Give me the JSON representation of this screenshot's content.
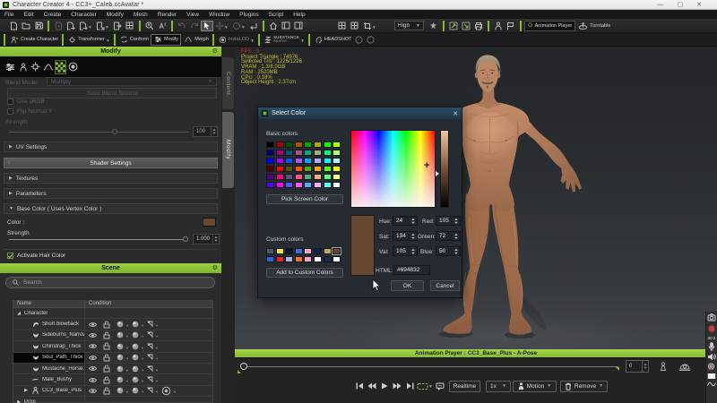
{
  "window": {
    "title": "Character Creator 4 - CC3+_Caleb.ccAvatar *",
    "controls": {
      "minimize": "—",
      "maximize": "▢",
      "close": "✕"
    }
  },
  "menu": {
    "items": [
      "File",
      "Edit",
      "Create",
      "Character",
      "Modify",
      "Mesh",
      "Render",
      "View",
      "Window",
      "Plugins",
      "Script",
      "Help"
    ]
  },
  "toolbar": {
    "icons_group1": [
      {
        "name": "new-document-icon",
        "icon": "doc"
      },
      {
        "name": "open-project-icon",
        "icon": "folder"
      },
      {
        "name": "save-project-icon",
        "icon": "save"
      }
    ],
    "icons_group2": [
      {
        "name": "import-file-icon",
        "icon": "doc-plus",
        "dim": true
      },
      {
        "name": "export-file-icon",
        "icon": "doc-arrow"
      },
      {
        "name": "send-to-iclone-icon",
        "icon": "doc-arrow2",
        "dd": true
      },
      {
        "name": "export-fbx-icon",
        "icon": "doc-arrow3",
        "dd": true
      },
      {
        "name": "goz-icon",
        "icon": "doc-out"
      },
      {
        "name": "texture-grid-icon",
        "icon": "grid"
      }
    ],
    "icons_group3": [
      {
        "name": "zoom-selected-icon",
        "icon": "zoom-a"
      },
      {
        "name": "zoom-all-icon",
        "icon": "zoom-b"
      }
    ],
    "icons_group4": [
      {
        "name": "undo-icon",
        "icon": "undo",
        "dim": true
      },
      {
        "name": "redo-icon",
        "icon": "redo",
        "dim": true
      },
      {
        "name": "select-tool-icon",
        "icon": "cursor",
        "active": true
      },
      {
        "name": "move-tool-icon",
        "icon": "move",
        "dim": true,
        "dd": true
      },
      {
        "name": "rotate-tool-icon",
        "icon": "rotate",
        "dim": true,
        "dd": true
      },
      {
        "name": "reset-transform-icon",
        "icon": "corner-arrow"
      }
    ],
    "icons_group5": [
      {
        "name": "home-camera-icon",
        "icon": "home"
      },
      {
        "name": "dock-left-icon",
        "icon": "panel"
      },
      {
        "name": "dock-right-icon",
        "icon": "panel2"
      }
    ],
    "icons_group6": [
      {
        "name": "preview-grid-icon",
        "icon": "grid"
      },
      {
        "name": "preview-grid2-icon",
        "icon": "grid"
      },
      {
        "name": "snapshot-icon",
        "icon": "crop",
        "dd": true
      }
    ],
    "quality_label": "High",
    "icons_group7": [
      {
        "name": "realtime-render-icon",
        "icon": "star"
      }
    ],
    "icons_group8": [
      {
        "name": "calibrate-a-icon",
        "icon": "lamp",
        "green": true
      },
      {
        "name": "calibrate-b-icon",
        "icon": "lamp2",
        "green": true
      },
      {
        "name": "render-image-icon",
        "icon": "printer"
      }
    ],
    "icons_group9": [
      {
        "name": "link-character-icon",
        "icon": "person"
      },
      {
        "name": "flag-pose-icon",
        "icon": "flag"
      }
    ],
    "animation_player_label": "Animation Player",
    "turntable_label": "Turntable"
  },
  "mode_toolbar": {
    "items": [
      {
        "label": "Create Character",
        "icon": "person-plus"
      },
      {
        "sep": true
      },
      {
        "label": "Transformer",
        "icon": "transformer",
        "dd": true
      },
      {
        "sep": true
      },
      {
        "label": "Conform",
        "icon": "conform"
      },
      {
        "label": "Modify",
        "icon": "sliders",
        "pressed": true
      },
      {
        "label": "Morph",
        "icon": "morph"
      },
      {
        "sep": true
      },
      {
        "label": "InstaLOD",
        "icon": "instalod",
        "dim": true,
        "dd": true
      },
      {
        "sep": true
      },
      {
        "label": "SUBSTANCE",
        "sublabel": "PAINTER",
        "icon": "substance",
        "dd": true
      },
      {
        "sep": true
      },
      {
        "label": "HEADSHOT",
        "icon": "headshot"
      }
    ]
  },
  "left_panel": {
    "modify": {
      "title": "Modify",
      "side_tabs": [
        "Content",
        "Modify"
      ],
      "tool_icons": [
        "adjust-sliders-icon",
        "skin-weight-icon",
        "bone-edit-icon",
        "sculpt-icon",
        "texture-checker-icon",
        "node-material-icon"
      ],
      "active_tool_index": 4,
      "blend_mode_label": "Blend Mode",
      "blend_mode_value": "Multiply",
      "save_blend_label": "Save Blend Texture",
      "use_srgb_label": "Use sRGB",
      "flip_normal_label": "Flip Normal Y",
      "strength_label": "Strength",
      "strength_value": "100",
      "uv_settings_label": "UV Settings",
      "shader_settings_label": "Shader Settings",
      "textures_label": "Textures",
      "parameters_label": "Parameters",
      "base_color_label": "Base Color ( Uses Vertex Color )",
      "color_label": "Color :",
      "color_value": "#694832",
      "strength2_label": "Strength",
      "strength2_value": "1.000",
      "activate_hair_label": "Activate Hair Color"
    },
    "scene": {
      "title": "Scene",
      "search_placeholder": "Search",
      "columns": [
        "Name",
        "Condition"
      ],
      "rows": [
        {
          "label": "Character",
          "group": true,
          "expanded": true,
          "level": 0
        },
        {
          "label": "Short blowback",
          "icon": "hair",
          "level": 1
        },
        {
          "label": "Sideburns_Narrow",
          "icon": "beard",
          "level": 1
        },
        {
          "label": "Chinstrap_Thick",
          "icon": "beard",
          "level": 1
        },
        {
          "label": "Soul_Path_Thick",
          "icon": "beard",
          "level": 1,
          "selected": true
        },
        {
          "label": "Mustache_Horse...",
          "icon": "beard",
          "level": 1
        },
        {
          "label": "Male_Bushy",
          "icon": "brow",
          "level": 1
        },
        {
          "label": "CC3_Base_Plus",
          "icon": "person",
          "level": 1,
          "expandable": true,
          "extra": true
        },
        {
          "label": "Prop",
          "group": true,
          "expanded": false,
          "level": 0
        }
      ],
      "condition_icons": [
        "visibility-eye-icon",
        "lock-icon",
        "material-ball-icon",
        "shadow-ball-icon",
        "render-state-icon"
      ],
      "extra_condition_icon": "physics-target-icon"
    }
  },
  "viewport": {
    "stats": [
      {
        "text": "FPS : 0",
        "red": true
      },
      {
        "text": "Project Triangle : 74976"
      },
      {
        "text": "Selected Tris : 1226/1226"
      },
      {
        "text": "VRAM : 1.3/8.0GB"
      },
      {
        "text": "RAM : 2520MB"
      },
      {
        "text": "CPU : 0.18%"
      },
      {
        "text": "Object Height : 2.37cm"
      }
    ]
  },
  "color_dialog": {
    "title": "Select Color",
    "basic_colors_label": "Basic colors",
    "pick_screen_label": "Pick Screen Color",
    "custom_colors_label": "Custom colors",
    "add_custom_label": "Add to Custom Colors",
    "hue_label": "Hue:",
    "hue_value": "24",
    "sat_label": "Sat:",
    "sat_value": "134",
    "val_label": "Val:",
    "val_value": "105",
    "red_label": "Red:",
    "red_value": "105",
    "green_label": "Green:",
    "green_value": "72",
    "blue_label": "Blue:",
    "blue_value": "50",
    "html_label": "HTML:",
    "html_value": "#694832",
    "ok_label": "OK",
    "cancel_label": "Cancel",
    "current_color": "#694832",
    "basic_colors": [
      "#000000",
      "#aa0000",
      "#005500",
      "#aa5500",
      "#00aa00",
      "#aaaa00",
      "#00ff00",
      "#aaff00",
      "#00007f",
      "#aa007f",
      "#00557f",
      "#aa557f",
      "#00aa7f",
      "#aaaa7f",
      "#00ff7f",
      "#aaff7f",
      "#0000ff",
      "#aa00ff",
      "#0055ff",
      "#aa55ff",
      "#00aaff",
      "#aaaaff",
      "#00ffff",
      "#aaffff",
      "#550000",
      "#ff0000",
      "#555500",
      "#ff5500",
      "#55aa00",
      "#ffaa00",
      "#55ff00",
      "#ffff00",
      "#55007f",
      "#ff007f",
      "#55557f",
      "#ff557f",
      "#55aa7f",
      "#ffaa7f",
      "#55ff7f",
      "#ffff7f",
      "#5500ff",
      "#ff00ff",
      "#5555ff",
      "#ff55ff",
      "#55aaff",
      "#ffaaff",
      "#55ffff",
      "#ffffff"
    ],
    "custom_colors": [
      "#4e5a66",
      "#f2e438",
      "#0a1430",
      "#3c6cd4",
      "#f2a8c4",
      "#122448",
      "#cba468",
      "#694832",
      "#2864e4",
      "#e02424",
      "#a8b4e4",
      "#f27224",
      "#f2a8bc",
      "#ffffff",
      "#122c54",
      "#ffffff"
    ],
    "custom_selected_index": 7
  },
  "bottom_bar": {
    "animation_player_text": "Animation Player : CC3_Base_Plus - A-Pose",
    "frame_value": "0",
    "transport_icons": [
      "skip-start-icon",
      "step-back-icon",
      "play-icon",
      "step-forward-icon",
      "skip-end-icon"
    ],
    "loop_icon": "loop-range-icon",
    "bubble_icon": "comment-bubble-icon",
    "realtime_label": "Realtime",
    "speed_value": "1x",
    "motion_label": "Motion",
    "remove_label": "Remove",
    "avatar_icon": "avatar-mark-icon",
    "camera_icon": "camera-dome-icon"
  },
  "recorder": {
    "time": "00:3",
    "icons": [
      "capture-settings-icon",
      "record-button-icon",
      "microphone-icon",
      "speaker-icon",
      "webcam-icon",
      "screen-rect-icon",
      "draw-tool-icon"
    ]
  }
}
